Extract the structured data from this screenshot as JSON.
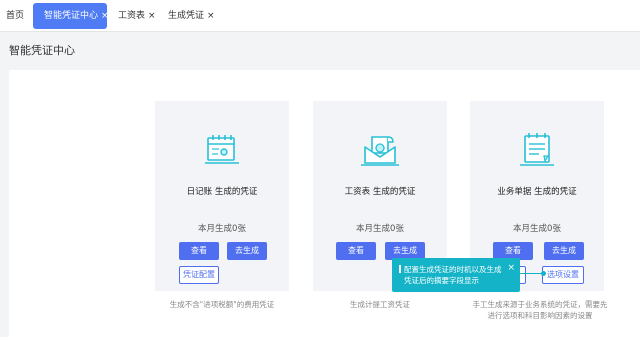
{
  "tabs": {
    "home": "首页",
    "active": "智能凭证中心",
    "salary": "工资表",
    "generate": "生成凭证",
    "close": "×"
  },
  "page": {
    "title": "智能凭证中心"
  },
  "cards": [
    {
      "title": "日记账 生成的凭证",
      "count": "本月生成0张",
      "view": "查看",
      "generate": "去生成",
      "config": "凭证配置",
      "desc": "生成不含\"进项税额\"的费用凭证",
      "icon": "calendar-journal-icon"
    },
    {
      "title": "工资表 生成的凭证",
      "count": "本月生成0张",
      "view": "查看",
      "generate": "去生成",
      "desc": "生成计提工资凭证",
      "icon": "salary-envelope-icon"
    },
    {
      "title": "业务单据 生成的凭证",
      "count": "本月生成0张",
      "view": "查看",
      "generate": "去生成",
      "settings": "选项设置",
      "partial": "置",
      "desc_line1": "手工生成来源于业务系统的凭证，需要先",
      "desc_line2": "进行选项和科目影响因素的设置",
      "icon": "business-document-icon"
    }
  ],
  "tooltip": {
    "line1": "配置生成凭证的时机以及生成",
    "line2": "凭证后的摘要字段显示",
    "close": "×"
  },
  "colors": {
    "accent": "#4f6ff0",
    "tab_active": "#4f7cf5",
    "tooltip": "#14b3c7",
    "icon": "#27c0d6"
  }
}
